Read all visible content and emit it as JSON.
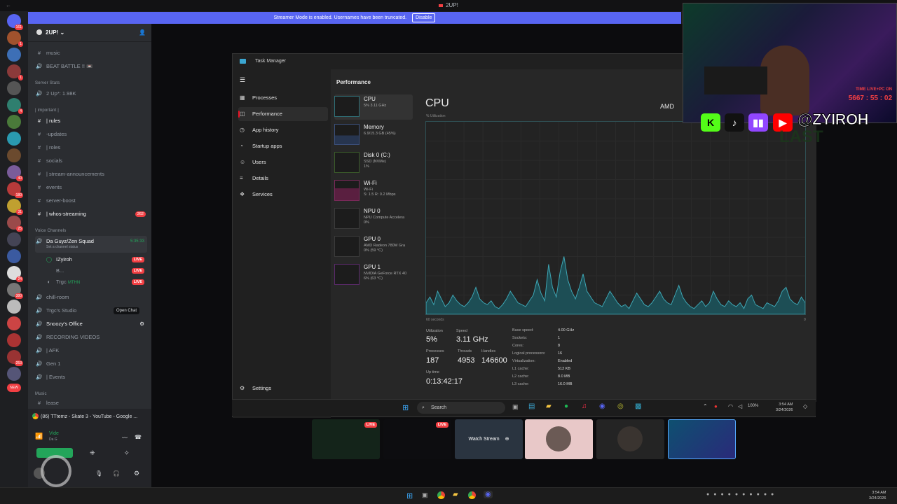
{
  "window": {
    "title": "2UP!"
  },
  "banner": {
    "text": "Streamer Mode is enabled. Usernames have been truncated.",
    "disable_label": "Disable"
  },
  "server": {
    "name": "2UP!"
  },
  "rail_badges": [
    "161",
    "1",
    "1",
    "1",
    "1",
    "4",
    "1",
    "40",
    "180",
    "31",
    "25",
    "1",
    "1",
    "24",
    "380",
    "1",
    "1",
    "253",
    "NEW"
  ],
  "channels": {
    "top": [
      {
        "icon": "#",
        "label": "music"
      },
      {
        "icon": "🔊",
        "label": "BEAT BATTLE !! 📼"
      }
    ],
    "server_stats_label": "Server Stats",
    "server_stats_item": "2 Up*: 1.98K",
    "important_label": "| important |",
    "important": [
      {
        "icon": "#",
        "label": "| rules",
        "bright": true
      },
      {
        "icon": "#",
        "label": "-updates"
      },
      {
        "icon": "#",
        "label": "| roles"
      },
      {
        "icon": "#",
        "label": "socials"
      },
      {
        "icon": "#",
        "label": "| stream-announcements"
      },
      {
        "icon": "#",
        "label": "events"
      },
      {
        "icon": "#",
        "label": "server-boost"
      },
      {
        "icon": "#",
        "label": "| whos-streaming",
        "bright": true,
        "count": "262"
      }
    ],
    "voice_label": "Voice Channels",
    "voice_channel": {
      "name": "Da Guyz/Zen Squad",
      "time": "5:35:33",
      "status": "Set a channel status"
    },
    "voice_users": [
      {
        "name": "IZyiroh",
        "live": "LIVE"
      },
      {
        "name": "B...",
        "live": "LIVE"
      },
      {
        "name": "Trgc",
        "tag": "MTHN",
        "live": "LIVE"
      }
    ],
    "more": [
      {
        "label": "chill-room"
      },
      {
        "label": "Trgc's Studio"
      },
      {
        "label": "Snoozy's Office",
        "bright": true
      },
      {
        "label": "RECORDING VIDEOS"
      },
      {
        "label": "| AFK"
      },
      {
        "label": "Gen 1"
      },
      {
        "label": "| Events"
      }
    ],
    "tooltip": "Open Chat",
    "music_label": "Music",
    "music_item": "lease"
  },
  "activity": {
    "text": "(86) TTtemz - Skate 3 - YouTube - Google ...",
    "video_label": "Vide",
    "sub": "Da G"
  },
  "task_manager": {
    "title": "Task Manager",
    "section": "Performance",
    "nav": [
      "Processes",
      "Performance",
      "App history",
      "Startup apps",
      "Users",
      "Details",
      "Services"
    ],
    "settings": "Settings",
    "devices": [
      {
        "name": "CPU",
        "detail": "5% 3.11 GHz"
      },
      {
        "name": "Memory",
        "detail": "6.9/15.3 GB (45%)"
      },
      {
        "name": "Disk 0 (C:)",
        "detail": "SSD (NVMe)\n1%"
      },
      {
        "name": "Wi-Fi",
        "detail": "Wi-Fi\nS: 1.5 R: 0.2 Mbps"
      },
      {
        "name": "NPU 0",
        "detail": "NPU Compute Accelera\n0%"
      },
      {
        "name": "GPU 0",
        "detail": "AMD Radeon 780M Gra\n0% (59 °C)"
      },
      {
        "name": "GPU 1",
        "detail": "NVIDIA GeForce RTX 40\n6% (63 °C)"
      }
    ],
    "header": "CPU",
    "brand": "AMD",
    "utilization_axis": "% Utilization",
    "time_axis": "60 seconds",
    "zero": "0",
    "stats": {
      "utilization_label": "Utilization",
      "utilization": "5%",
      "speed_label": "Speed",
      "speed": "3.11 GHz",
      "processes_label": "Processes",
      "processes": "187",
      "threads_label": "Threads",
      "threads": "4953",
      "handles_label": "Handles",
      "handles": "146600",
      "uptime_label": "Up time",
      "uptime": "0:13:42:17"
    },
    "specs": [
      {
        "k": "Base speed:",
        "v": "4.00 GHz"
      },
      {
        "k": "Sockets:",
        "v": "1"
      },
      {
        "k": "Cores:",
        "v": "8"
      },
      {
        "k": "Logical processors:",
        "v": "16"
      },
      {
        "k": "Virtualization:",
        "v": "Enabled"
      },
      {
        "k": "L1 cache:",
        "v": "512 KB"
      },
      {
        "k": "L2 cache:",
        "v": "8.0 MB"
      },
      {
        "k": "L3 cache:",
        "v": "16.0 MB"
      }
    ],
    "cpu_history": [
      6,
      9,
      5,
      12,
      8,
      4,
      6,
      10,
      7,
      5,
      4,
      6,
      9,
      14,
      8,
      6,
      5,
      7,
      4,
      3,
      5,
      8,
      12,
      9,
      6,
      5,
      4,
      7,
      10,
      18,
      11,
      7,
      26,
      14,
      9,
      22,
      30,
      18,
      12,
      8,
      14,
      21,
      12,
      9,
      6,
      5,
      4,
      8,
      12,
      9,
      6,
      4,
      5,
      3,
      7,
      11,
      8,
      5,
      4,
      6,
      9,
      12,
      8,
      6,
      5,
      10,
      15,
      9,
      6,
      4,
      3,
      5,
      7,
      4,
      6,
      12,
      8,
      5,
      4,
      7,
      5,
      4,
      6,
      3,
      8,
      10,
      5,
      4,
      3,
      6,
      5,
      4,
      7,
      12,
      14,
      8,
      6,
      5,
      9,
      6
    ]
  },
  "inner_taskbar": {
    "search": "Search",
    "time": "3:54 AM",
    "date": "3/24/2026",
    "battery": "100%"
  },
  "stream_cards": {
    "watch": "Watch Stream",
    "live": "LIVE"
  },
  "taskbar": {
    "time": "3:54 AM",
    "date": "3/24/2026"
  },
  "overlay": {
    "handle": "@ZYIROH",
    "label": "TIME LIVE+PC ON",
    "timer": "5667 : 55 : 02",
    "last": "LAST"
  }
}
